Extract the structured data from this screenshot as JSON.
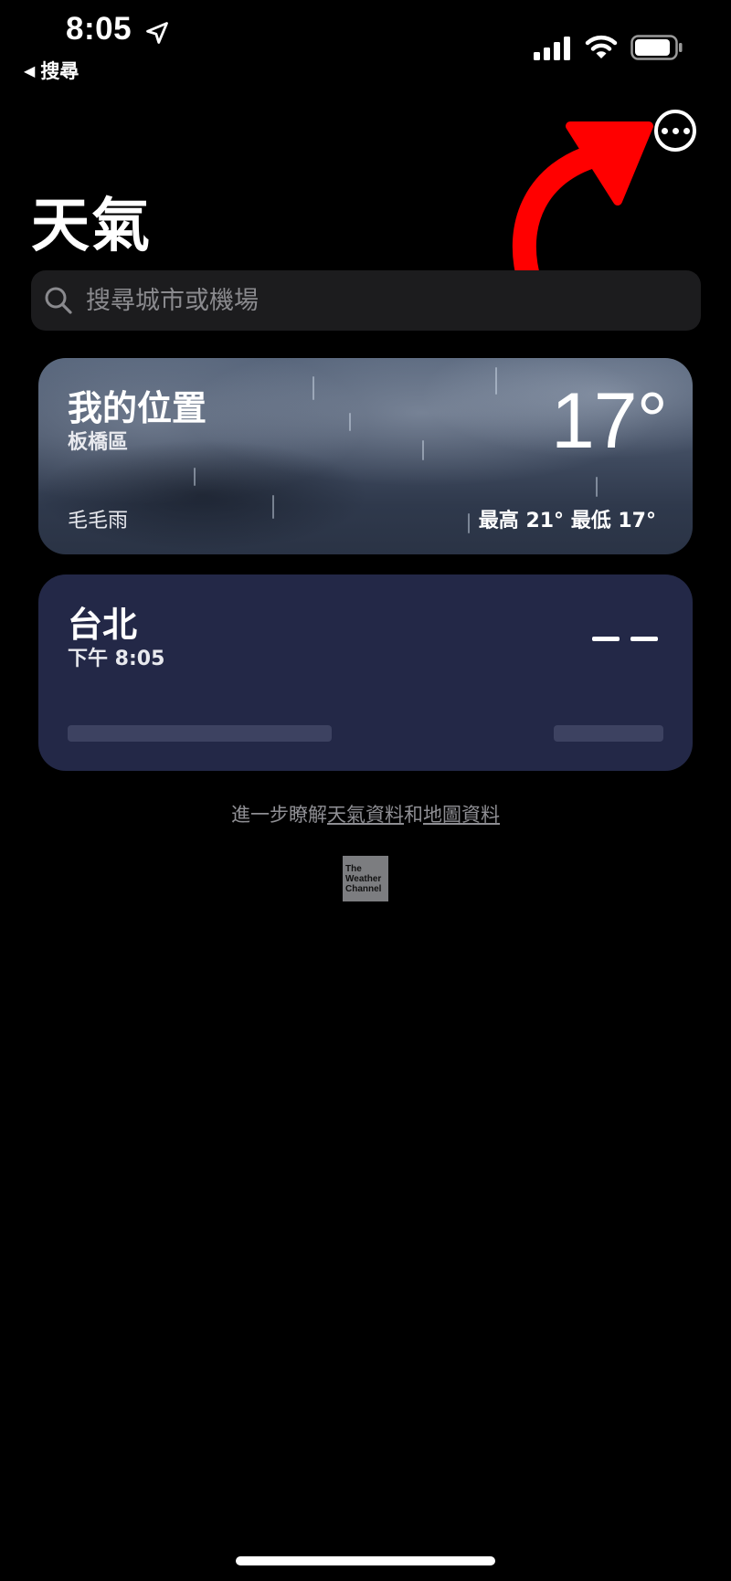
{
  "status_bar": {
    "time": "8:05",
    "back_label": "搜尋"
  },
  "header": {
    "title": "天氣",
    "more_icon": "ellipsis-circle-icon"
  },
  "search": {
    "placeholder": "搜尋城市或機場"
  },
  "locations": [
    {
      "name": "我的位置",
      "subtitle": "板橋區",
      "temperature": "17°",
      "condition": "毛毛雨",
      "high_low": "最高 21°  最低 17°"
    },
    {
      "name": "台北",
      "subtitle": "下午 8:05",
      "temperature": "– –"
    }
  ],
  "attribution": {
    "prefix": "進一步瞭解",
    "weather_link": "天氣資料",
    "joiner": "和",
    "map_link": "地圖資料"
  },
  "logo": {
    "line1": "The",
    "line2": "Weather",
    "line3": "Channel"
  },
  "colors": {
    "annotation_arrow": "#ff0000",
    "taipei_card": "#232847"
  }
}
